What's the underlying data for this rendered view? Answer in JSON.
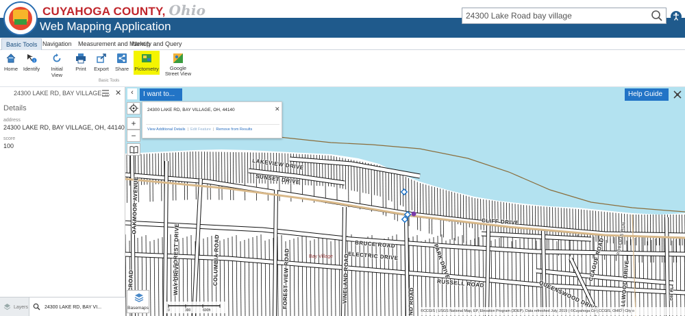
{
  "header": {
    "county_name": "CUYAHOGA COUNTY,",
    "state_name": "Ohio",
    "app_title": "Web Mapping Application",
    "search_value": "24300 Lake Road bay village"
  },
  "ribbon": {
    "tabs": [
      "Basic Tools",
      "Navigation",
      "Measurement and Markup",
      "Identify and Query"
    ],
    "active_tab": "Basic Tools",
    "tools": [
      {
        "label": "Home",
        "icon": "home-icon"
      },
      {
        "label": "Identify",
        "icon": "identify-icon"
      },
      {
        "label": "Initial View",
        "icon": "initial-view-icon"
      },
      {
        "label": "Print",
        "icon": "print-icon"
      },
      {
        "label": "Export",
        "icon": "export-icon"
      },
      {
        "label": "Share",
        "icon": "share-icon"
      },
      {
        "label": "Pictometry",
        "icon": "pictometry-icon"
      },
      {
        "label": "Google Street View",
        "icon": "street-view-icon"
      }
    ],
    "group_label": "Basic Tools",
    "highlighted_tool": "Pictometry",
    "highlight_color": "#f4f400"
  },
  "left_panel": {
    "title": "24300 LAKE RD, BAY VILLAGE, ...",
    "section": "Details",
    "fields": [
      {
        "label": "address",
        "value": "24300 LAKE RD, BAY VILLAGE, OH, 44140"
      },
      {
        "label": "score",
        "value": "100"
      }
    ],
    "bottom_tabs": [
      {
        "label": "Layers"
      },
      {
        "label": "24300 LAKE RD, BAY VI..."
      }
    ]
  },
  "map": {
    "iwant_label": "I want to...",
    "help_label": "Help Guide",
    "popup": {
      "address": "24300 LAKE RD, BAY VILLAGE, OH, 44140",
      "link_details": "View Additional Details",
      "link_edit": "Edit Feature",
      "link_remove": "Remove from Results"
    },
    "basemaps_label": "Basemaps",
    "scale_labels": [
      "0",
      "300",
      "600ft"
    ],
    "attribution": "©CCGIS | USGS National Map, EP, Elevation Program (3DEP). Data refreshed July, 2019 | ©Cuyahoga Co | CCGIS, OHIO | City o",
    "street_labels": [
      "LAKEVIEW DRIVE",
      "SUNSET DRIVE",
      "CLIFF DRIVE",
      "BRUCE ROAD",
      "ELECTRIC DRIVE",
      "PARK DRIVE",
      "RUSSELL ROAD",
      "QUEENSWOOD DRIVE",
      "OAKMOOR AVENUE",
      "LAKE FOREST DRIVE",
      "COLUMBIA ROAD",
      "WAY DRIVE",
      "FOREST VIEW ROAD",
      "VINELAND ROAD",
      "CLAGUE ROAD",
      "ALLWOOD DRIVE",
      "ND ROAD",
      "CROAD",
      "ROBERTS RUN",
      "ON PL"
    ],
    "place_label": "Bay Village",
    "water_color": "#b3e2f0",
    "road_color": "#d9b98a"
  }
}
